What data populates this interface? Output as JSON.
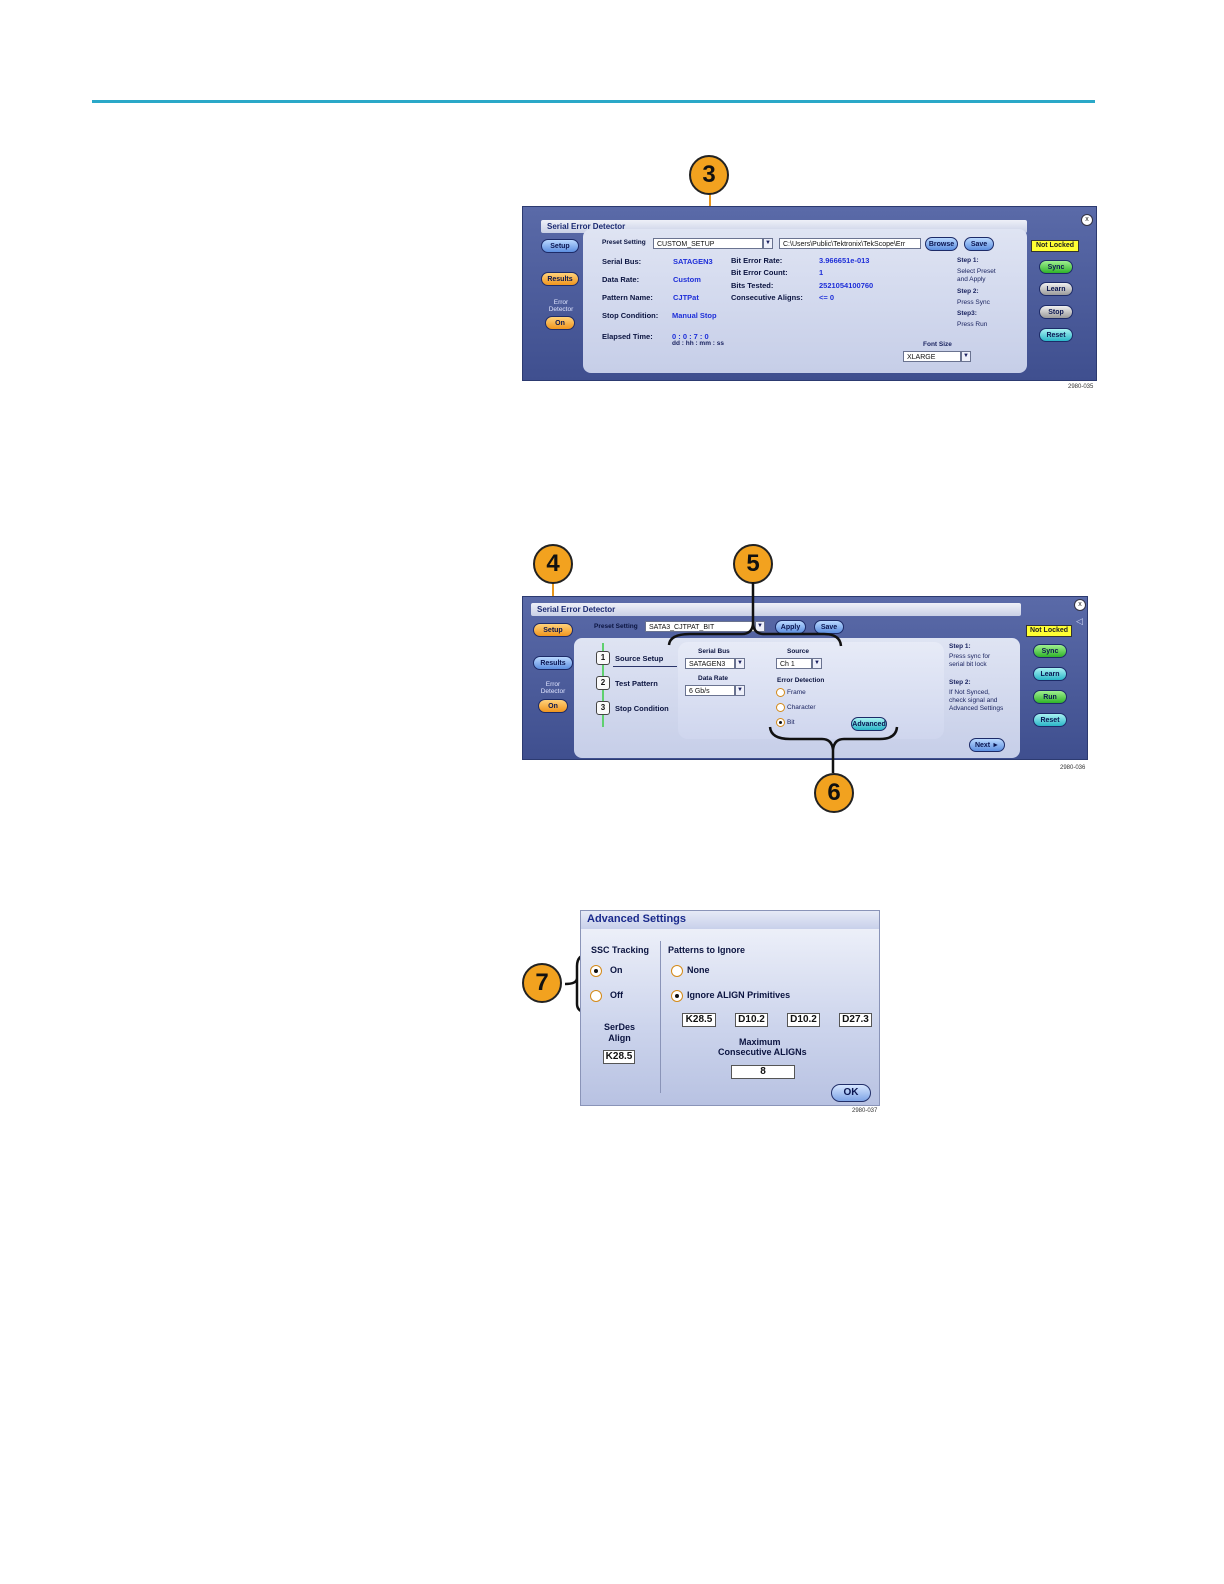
{
  "fig1": {
    "callout": "3",
    "title": "Serial Error Detector",
    "close": "x",
    "side": {
      "setup": "Setup",
      "results": "Results",
      "ed_label": "Error Detector",
      "ed_value": "On"
    },
    "preset_label": "Preset Setting",
    "preset_value": "CUSTOM_SETUP",
    "path_value": "C:\\Users\\Public\\Tektronix\\TekScope\\Err",
    "browse": "Browse",
    "save": "Save",
    "fields": {
      "serial_bus_label": "Serial Bus:",
      "serial_bus_value": "SATAGEN3",
      "data_rate_label": "Data Rate:",
      "data_rate_value": "Custom",
      "pattern_label": "Pattern Name:",
      "pattern_value": "CJTPat",
      "stop_label": "Stop Condition:",
      "stop_value": "Manual Stop",
      "elapsed_label": "Elapsed Time:",
      "elapsed_value": "0 : 0 : 7 : 0",
      "elapsed_units": "dd : hh : mm : ss",
      "ber_label": "Bit Error Rate:",
      "ber_value": "3.966651e-013",
      "bec_label": "Bit Error Count:",
      "bec_value": "1",
      "bt_label": "Bits Tested:",
      "bt_value": "2521054100760",
      "ca_label": "Consecutive Aligns:",
      "ca_value": "<= 0"
    },
    "steps": {
      "s1": "Step 1:",
      "s1a": "Select Preset",
      "s1b": "and Apply",
      "s2": "Step 2:",
      "s2a": "Press Sync",
      "s3": "Step3:",
      "s3a": "Press Run"
    },
    "font_label": "Font Size",
    "font_value": "XLARGE",
    "status": "Not Locked",
    "right_buttons": {
      "sync": "Sync",
      "learn": "Learn",
      "stop": "Stop",
      "reset": "Reset"
    },
    "fignum": "2980-035"
  },
  "fig2": {
    "callout_a": "4",
    "callout_b": "5",
    "callout_c": "6",
    "title": "Serial Error Detector",
    "close": "x",
    "side": {
      "setup": "Setup",
      "results": "Results",
      "ed_label": "Error Detector",
      "ed_value": "On"
    },
    "preset_label": "Preset Setting",
    "preset_value": "SATA3_CJTPAT_BIT",
    "apply": "Apply",
    "save": "Save",
    "wizard": [
      {
        "num": "1",
        "label": "Source Setup"
      },
      {
        "num": "2",
        "label": "Test Pattern"
      },
      {
        "num": "3",
        "label": "Stop Condition"
      }
    ],
    "serial_bus_label": "Serial Bus",
    "serial_bus_value": "SATAGEN3",
    "source_label": "Source",
    "source_value": "Ch 1",
    "data_rate_label": "Data Rate",
    "data_rate_value": "6 Gb/s",
    "error_detection_label": "Error Detection",
    "ed_options": [
      "Frame",
      "Character",
      "Bit"
    ],
    "ed_selected": "Bit",
    "advanced": "Advanced",
    "next": "Next ►",
    "steps": {
      "s1": "Step 1:",
      "s1a": "Press sync for",
      "s1b": "serial bit lock",
      "s2": "Step 2:",
      "s2a": "If Not Synced,",
      "s2b": "check signal and",
      "s2c": "Advanced Settings"
    },
    "status": "Not Locked",
    "right_buttons": {
      "sync": "Sync",
      "learn": "Learn",
      "run": "Run",
      "reset": "Reset"
    },
    "fignum": "2980-036"
  },
  "fig3": {
    "callout": "7",
    "title": "Advanced Settings",
    "ssc_label": "SSC Tracking",
    "ssc_on": "On",
    "ssc_off": "Off",
    "ssc_selected": "On",
    "serdes_label": "SerDes Align",
    "serdes_value": "K28.5",
    "patterns_label": "Patterns to Ignore",
    "none": "None",
    "ignore_align": "Ignore ALIGN Primitives",
    "patterns_selected": "Ignore ALIGN Primitives",
    "align_chars": [
      "K28.5",
      "D10.2",
      "D10.2",
      "D27.3"
    ],
    "max_label_1": "Maximum",
    "max_label_2": "Consecutive ALIGNs",
    "max_value": "8",
    "ok": "OK",
    "fignum": "2980-037"
  }
}
